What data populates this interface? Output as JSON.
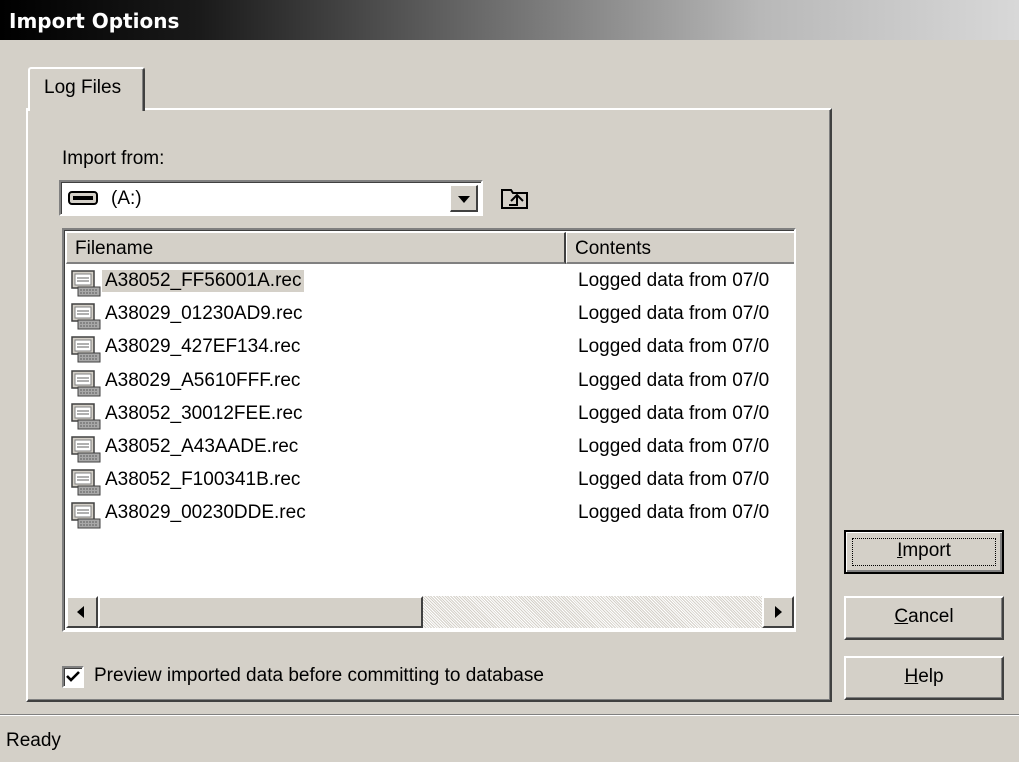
{
  "window": {
    "title": "Import Options"
  },
  "tabs": [
    {
      "label": "Log Files"
    }
  ],
  "import_from": {
    "label": "Import from:",
    "selected": "(A:)",
    "drive_icon": "floppy-drive-icon",
    "up_icon": "up-one-level-icon"
  },
  "file_list": {
    "columns": [
      "Filename",
      "Contents"
    ],
    "rows": [
      {
        "filename": "A38052_FF56001A.rec",
        "contents": "Logged data from 07/0",
        "selected": true
      },
      {
        "filename": "A38029_01230AD9.rec",
        "contents": "Logged data from 07/0"
      },
      {
        "filename": "A38029_427EF134.rec",
        "contents": "Logged data from 07/0"
      },
      {
        "filename": "A38029_A5610FFF.rec",
        "contents": "Logged data from 07/0"
      },
      {
        "filename": "A38052_30012FEE.rec",
        "contents": "Logged data from 07/0"
      },
      {
        "filename": "A38052_A43AADE.rec",
        "contents": "Logged data from 07/0"
      },
      {
        "filename": "A38052_F100341B.rec",
        "contents": "Logged data from 07/0"
      },
      {
        "filename": "A38029_00230DDE.rec",
        "contents": "Logged data from 07/0"
      }
    ],
    "file_icon": "log-file-icon"
  },
  "preview": {
    "label": "Preview imported data before committing to database",
    "checked": true
  },
  "buttons": {
    "import": {
      "label": "Import",
      "accel": "I"
    },
    "cancel": {
      "label": "Cancel",
      "accel": "C"
    },
    "help": {
      "label": "Help",
      "accel": "H"
    }
  },
  "status": {
    "text": "Ready"
  }
}
